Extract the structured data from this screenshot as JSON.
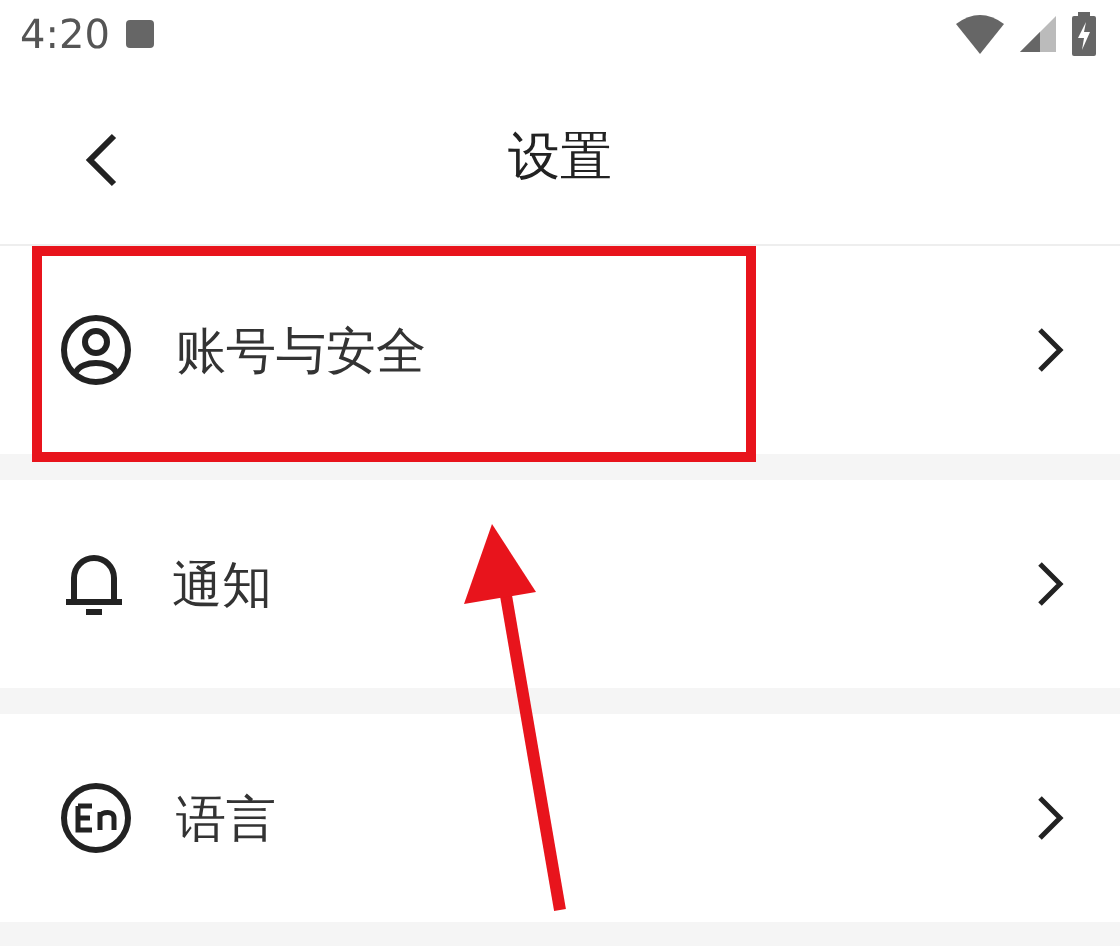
{
  "status_bar": {
    "time": "4:20"
  },
  "header": {
    "title": "设置"
  },
  "groups": [
    {
      "items": [
        {
          "kind": "account",
          "label": "账号与安全"
        }
      ]
    },
    {
      "items": [
        {
          "kind": "notification",
          "label": "通知"
        }
      ]
    },
    {
      "items": [
        {
          "kind": "language",
          "label": "语言"
        }
      ]
    }
  ]
}
